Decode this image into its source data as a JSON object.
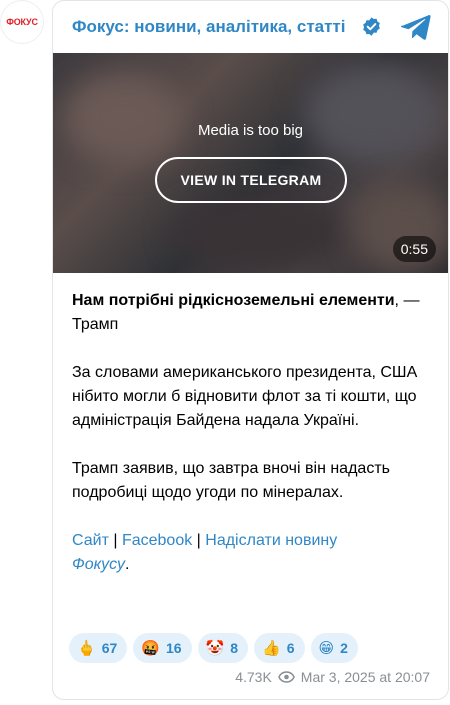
{
  "channel": {
    "avatar_text": "ФОКУС",
    "title": "Фокус: новини, аналітика, статті"
  },
  "media": {
    "notice": "Media is too big",
    "view_button": "VIEW IN TELEGRAM",
    "duration": "0:55"
  },
  "post": {
    "headline_bold": "Нам потрібні рідкісноземельні елементи",
    "headline_rest": ", — Трамп",
    "paragraph1": "За словами американського президента, США нібито могли б відновити флот за ті кошти, що адміністрація Байдена надала Україні.",
    "paragraph2": "Трамп заявив, що завтра вночі він надасть подробиці щодо угоди по мінералах.",
    "links": {
      "site": "Сайт",
      "sep1": " | ",
      "facebook": "Facebook",
      "sep2": " | ",
      "send_news": "Надіслати новину",
      "focus": "Фокусу",
      "end": "."
    }
  },
  "reactions": [
    {
      "emoji": "🖕",
      "icon": "middle-finger-emoji",
      "count": "67"
    },
    {
      "emoji": "🤬",
      "icon": "cursing-face-emoji",
      "count": "16"
    },
    {
      "emoji": "🤡",
      "icon": "clown-face-emoji",
      "count": "8"
    },
    {
      "emoji": "👍",
      "icon": "thumbs-up-emoji",
      "count": "6"
    },
    {
      "emoji": "😁",
      "icon": "grinning-face-emoji",
      "count": "2"
    }
  ],
  "footer": {
    "views": "4.73K",
    "timestamp": "Mar 3, 2025 at 20:07"
  },
  "colors": {
    "accent": "#2f87c6",
    "reaction_bg": "#e4f1fb",
    "meta": "#8a8f94",
    "brand_red": "#e01f26"
  }
}
